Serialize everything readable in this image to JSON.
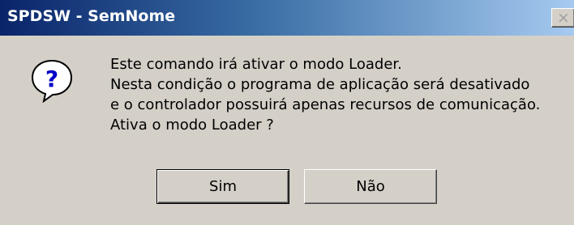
{
  "window": {
    "title": "SPDSW - SemNome",
    "close_glyph": "×"
  },
  "icon": {
    "name": "question-icon",
    "glyph": "?",
    "color": "#0000c8"
  },
  "message": {
    "lines": [
      "Este comando irá ativar o modo Loader.",
      "Nesta condição o programa de aplicação será desativado",
      "e o controlador possuirá apenas recursos de comunicação.",
      "Ativa o modo Loader ?"
    ]
  },
  "buttons": {
    "yes_label": "Sim",
    "no_label": "Não"
  },
  "colors": {
    "titlebar_start": "#0a246a",
    "titlebar_end": "#a6caf0",
    "face": "#d4d0c8"
  }
}
